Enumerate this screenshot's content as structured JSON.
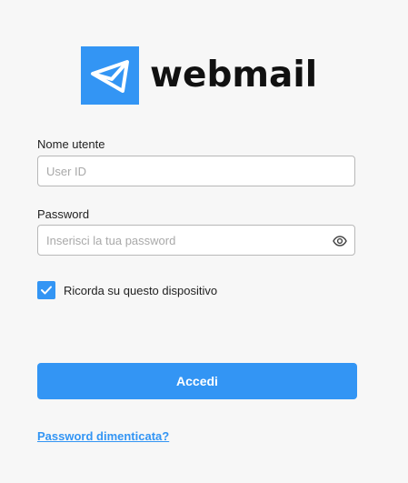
{
  "brand": {
    "name": "webmail",
    "logo_icon": "envelope-icon",
    "accent_color": "#3395f4"
  },
  "form": {
    "username": {
      "label": "Nome utente",
      "placeholder": "User ID",
      "value": ""
    },
    "password": {
      "label": "Password",
      "placeholder": "Inserisci la tua password",
      "value": "",
      "toggle_icon": "eye-icon"
    },
    "remember": {
      "label": "Ricorda su questo dispositivo",
      "checked": true,
      "check_icon": "checkmark-icon"
    },
    "submit_label": "Accedi",
    "forgot_label": "Password dimenticata?"
  }
}
